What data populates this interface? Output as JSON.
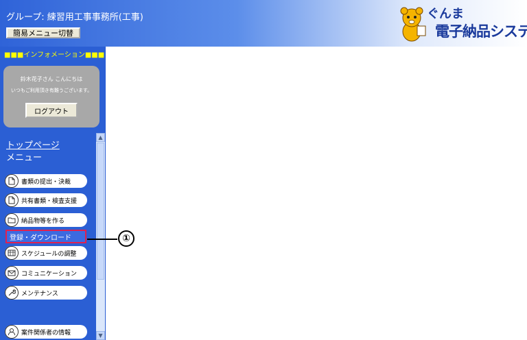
{
  "header": {
    "group_title": "グループ: 練習用工事事務所(工事)",
    "simple_menu_button": "簡易メニュー切替",
    "logo_line1": "ぐんま",
    "logo_line2": "電子納品システム"
  },
  "sidebar": {
    "info_heading": "■■■インフォメーション■■■",
    "greeting": "鈴木花子さん こんにちは",
    "greeting2": "いつもご利用頂き有難うございます。",
    "logout_button": "ログアウト",
    "top_page_link": "トップページ",
    "menu_label": "メニュー",
    "menu_items": [
      {
        "label": "書類の提出・決裁",
        "icon": "document-icon"
      },
      {
        "label": "共有書類・検査支援",
        "icon": "document-icon"
      },
      {
        "label": "納品物等を作る",
        "icon": "folder-icon"
      },
      {
        "label": "登録・ダウンロード",
        "icon": "",
        "selected": true
      },
      {
        "label": "スケジュールの調整",
        "icon": "calendar-icon"
      },
      {
        "label": "コミュニケーション",
        "icon": "mail-icon"
      },
      {
        "label": "メンテナンス",
        "icon": "wrench-icon"
      },
      {
        "label": "案件関係者の情報",
        "icon": "person-icon"
      }
    ]
  },
  "annotation": {
    "number": "①"
  },
  "colors": {
    "sidebar_bg": "#2b5fd4",
    "highlight_border": "#e02050",
    "info_heading": "#ffff00"
  }
}
